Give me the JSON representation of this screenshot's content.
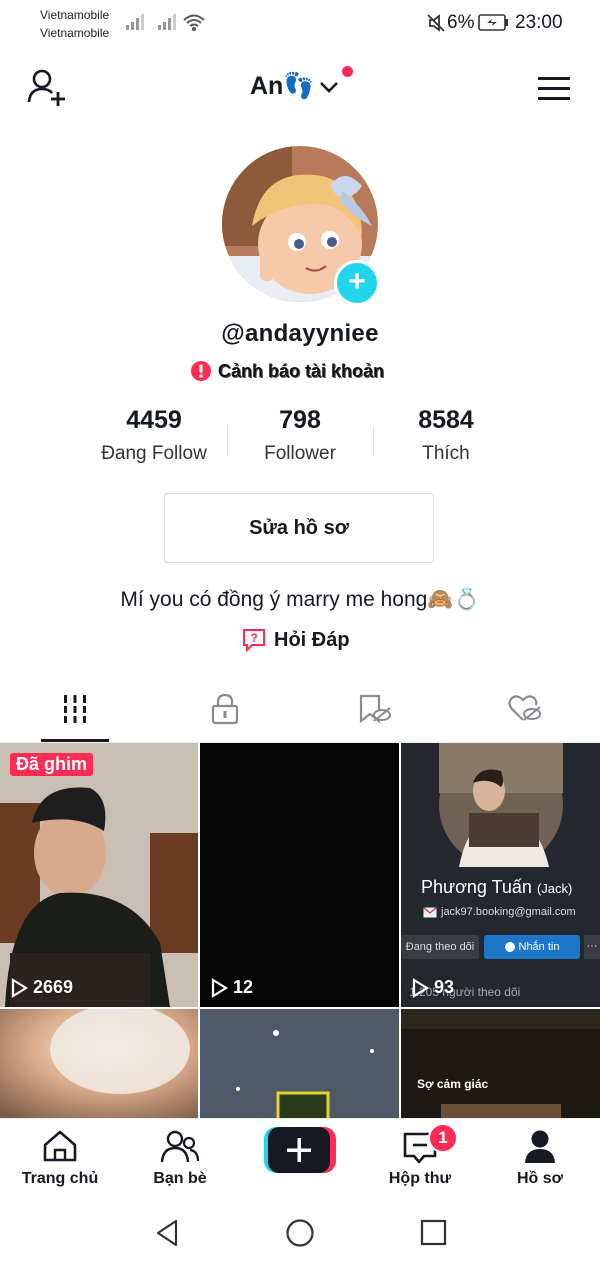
{
  "status_bar": {
    "carrier_1": "Vietnamobile",
    "carrier_2": "Vietnamobile",
    "battery": "6%",
    "time": "23:00"
  },
  "header": {
    "username": "An👣",
    "has_notification_dot": true,
    "notification_dot_color": "#fe2c55"
  },
  "profile": {
    "handle": "@andayyniee",
    "warning_label": "Cảnh báo tài khoản",
    "stats": [
      {
        "value": "4459",
        "label": "Đang Follow"
      },
      {
        "value": "798",
        "label": "Follower"
      },
      {
        "value": "8584",
        "label": "Thích"
      }
    ],
    "edit_button": "Sửa hồ sơ",
    "bio": "Mí you có đồng ý marry me hong🙈💍",
    "qa_label": "Hỏi Đáp"
  },
  "tabs": [
    {
      "icon": "grid-icon",
      "active": true
    },
    {
      "icon": "lock-icon",
      "active": false
    },
    {
      "icon": "hidden-bookmark-icon",
      "active": false
    },
    {
      "icon": "hidden-heart-icon",
      "active": false
    }
  ],
  "videos": [
    {
      "pinned_label": "Đã ghim",
      "plays": "2669"
    },
    {
      "plays": "12"
    },
    {
      "plays": "93",
      "overlay": {
        "name": "Phương Tuấn",
        "tag": "(Jack)",
        "email": "jack97.booking@gmail.com",
        "follow_btn": "Đang theo dõi",
        "msg_btn": "Nhắn tin",
        "followers": "1.205 người theo dõi"
      }
    },
    {
      "plays": ""
    },
    {
      "plays": ""
    },
    {
      "plays": "",
      "caption": "Sợ cảm giác"
    }
  ],
  "bottom_nav": {
    "items": [
      {
        "label": "Trang chủ",
        "icon": "home-icon"
      },
      {
        "label": "Bạn bè",
        "icon": "friends-icon"
      },
      {
        "label": "",
        "icon": "create-plus-icon"
      },
      {
        "label": "Hộp thư",
        "icon": "inbox-icon",
        "badge": "1"
      },
      {
        "label": "Hồ sơ",
        "icon": "profile-icon"
      }
    ]
  },
  "colors": {
    "accent": "#fe2c55",
    "cyan": "#20d5ec",
    "text": "#161823"
  }
}
